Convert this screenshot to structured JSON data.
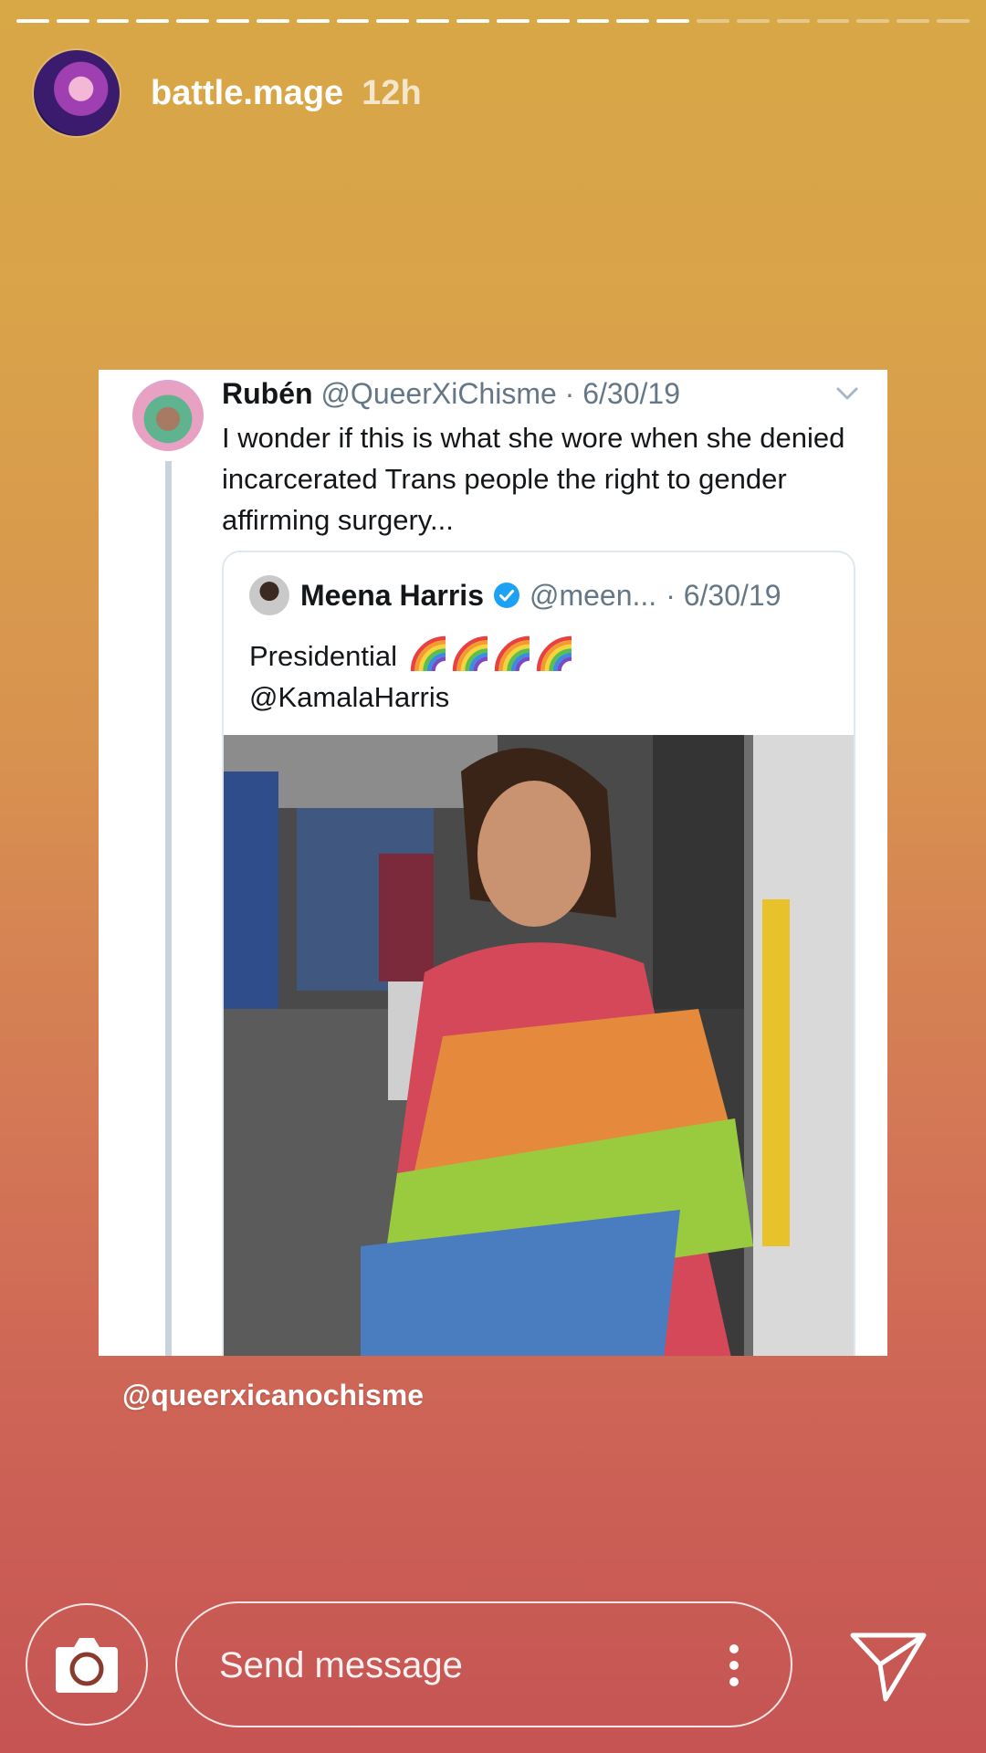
{
  "story": {
    "progress": {
      "total_segments": 24,
      "completed_segments": 17
    },
    "username": "battle.mage",
    "time": "12h",
    "mention": "@queerxicanochisme"
  },
  "tweet": {
    "name": "Rubén",
    "handle": "@QueerXiChisme",
    "date": "· 6/30/19",
    "text": "I wonder if this is what she wore when she denied incarcerated Trans people the right to gender affirming surgery...",
    "quoted": {
      "name": "Meena Harris",
      "handle": "@meen...",
      "date": "· 6/30/19",
      "text_line1": "Presidential",
      "text_line2": "@KamalaHarris",
      "emoji_count": 4
    }
  },
  "bottom_bar": {
    "message_placeholder": "Send message"
  },
  "icons": [
    "camera-icon",
    "more-vertical-icon",
    "send-icon",
    "chevron-down-icon",
    "verified-badge-icon",
    "rainbow-emoji"
  ],
  "colors": {
    "verified": "#1da1f2",
    "text": "#14171a",
    "muted": "#657786"
  }
}
